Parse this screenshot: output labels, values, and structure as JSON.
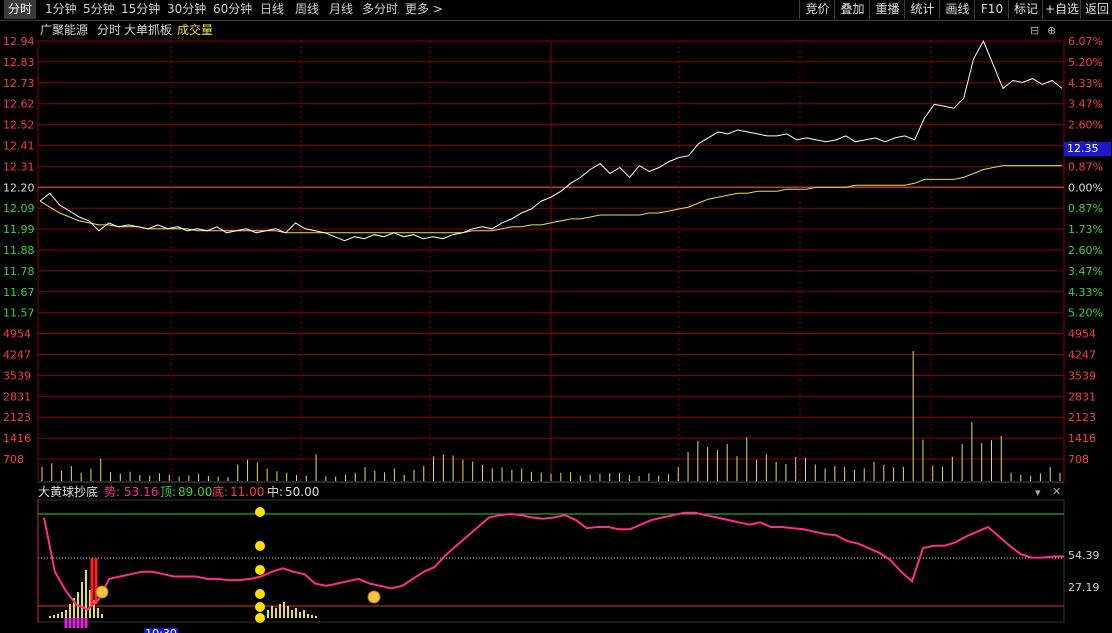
{
  "toolbar": {
    "tabs": [
      "分时",
      "1分钟",
      "5分钟",
      "15分钟",
      "30分钟",
      "60分钟",
      "日线",
      "周线",
      "月线",
      "多分时",
      "更多 >"
    ],
    "right_buttons": [
      "竞价",
      "叠加",
      "重播",
      "统计",
      "画线",
      "F10",
      "标记",
      "+自选",
      "返回"
    ]
  },
  "header": {
    "stock_name": "广聚能源",
    "view": "分时",
    "feature": "大单抓板",
    "volume_label": "成交量"
  },
  "price_axis": {
    "left": [
      "12.94",
      "12.83",
      "12.73",
      "12.62",
      "12.52",
      "12.41",
      "12.31",
      "12.20",
      "12.09",
      "11.99",
      "11.88",
      "11.78",
      "11.67",
      "11.57"
    ],
    "right": [
      "6.07%",
      "5.20%",
      "4.33%",
      "3.47%",
      "2.60%",
      "1.73%",
      "0.87%",
      "0.00%",
      "0.87%",
      "1.73%",
      "2.60%",
      "3.47%",
      "4.33%",
      "5.20%"
    ],
    "current_price": "12.35"
  },
  "volume_axis": [
    "4954",
    "4247",
    "3539",
    "2831",
    "2123",
    "1416",
    "708"
  ],
  "indicator": {
    "name": "大黄球抄底",
    "shi_label": "势:",
    "shi_value": "53.16",
    "ding_label": "顶:",
    "ding_value": "89.00",
    "di_label": "底:",
    "di_value": "11.00",
    "zhong_label": "中:",
    "zhong_value": "50.00",
    "right_labels": [
      "54.39",
      "27.19"
    ]
  },
  "time_axis": [
    "10:30"
  ],
  "colors": {
    "up": "#ff3b3b",
    "down": "#37d437",
    "price_line": "#ffffff",
    "avg_line": "#e8e04a",
    "grid": "#8b0000",
    "volume": "#e8e04a",
    "indicator": "#ff2d8a",
    "yellow_ball": "#ffe000"
  },
  "chart_data": {
    "type": "line",
    "prev_close": 12.2,
    "price": [
      12.13,
      12.17,
      12.11,
      12.08,
      12.05,
      12.03,
      11.98,
      12.02,
      12.0,
      12.01,
      12.0,
      11.99,
      12.01,
      11.99,
      12.0,
      11.98,
      11.99,
      11.98,
      12.0,
      11.97,
      11.98,
      11.99,
      11.97,
      11.98,
      11.99,
      11.97,
      12.02,
      11.99,
      11.98,
      11.97,
      11.95,
      11.93,
      11.95,
      11.94,
      11.96,
      11.95,
      11.97,
      11.95,
      11.96,
      11.94,
      11.95,
      11.94,
      11.96,
      11.97,
      11.99,
      12.0,
      11.99,
      12.02,
      12.04,
      12.07,
      12.09,
      12.13,
      12.15,
      12.18,
      12.22,
      12.25,
      12.29,
      12.32,
      12.27,
      12.3,
      12.25,
      12.31,
      12.28,
      12.3,
      12.33,
      12.35,
      12.36,
      12.42,
      12.45,
      12.48,
      12.47,
      12.49,
      12.48,
      12.47,
      12.46,
      12.46,
      12.47,
      12.44,
      12.45,
      12.44,
      12.43,
      12.44,
      12.46,
      12.43,
      12.44,
      12.45,
      12.43,
      12.45,
      12.46,
      12.44,
      12.55,
      12.62,
      12.61,
      12.6,
      12.65,
      12.85,
      12.94,
      12.82,
      12.7,
      12.74,
      12.73,
      12.75,
      12.72,
      12.74,
      12.7
    ],
    "avg_price": [
      12.13,
      12.1,
      12.07,
      12.05,
      12.03,
      12.02,
      12.01,
      12.01,
      12.0,
      12.0,
      12.0,
      11.99,
      11.99,
      11.99,
      11.99,
      11.99,
      11.98,
      11.98,
      11.98,
      11.98,
      11.98,
      11.98,
      11.98,
      11.98,
      11.98,
      11.97,
      11.97,
      11.97,
      11.97,
      11.97,
      11.97,
      11.97,
      11.97,
      11.97,
      11.97,
      11.97,
      11.97,
      11.97,
      11.97,
      11.97,
      11.97,
      11.97,
      11.97,
      11.97,
      11.98,
      11.98,
      11.98,
      11.99,
      12.0,
      12.0,
      12.01,
      12.01,
      12.02,
      12.03,
      12.04,
      12.04,
      12.05,
      12.06,
      12.06,
      12.06,
      12.06,
      12.06,
      12.07,
      12.07,
      12.08,
      12.09,
      12.1,
      12.12,
      12.14,
      12.15,
      12.16,
      12.17,
      12.17,
      12.18,
      12.18,
      12.18,
      12.19,
      12.19,
      12.19,
      12.2,
      12.2,
      12.2,
      12.2,
      12.21,
      12.21,
      12.21,
      12.21,
      12.21,
      12.21,
      12.22,
      12.24,
      12.24,
      12.24,
      12.24,
      12.25,
      12.27,
      12.29,
      12.3,
      12.31,
      12.31,
      12.31,
      12.31,
      12.31,
      12.31,
      12.31
    ],
    "volume": [
      480,
      600,
      350,
      500,
      280,
      420,
      760,
      300,
      250,
      310,
      200,
      180,
      260,
      210,
      150,
      190,
      240,
      170,
      150,
      130,
      560,
      720,
      610,
      420,
      330,
      280,
      200,
      180,
      900,
      160,
      150,
      220,
      280,
      470,
      340,
      300,
      420,
      210,
      380,
      510,
      830,
      900,
      860,
      720,
      660,
      540,
      430,
      460,
      380,
      420,
      310,
      290,
      250,
      280,
      300,
      180,
      220,
      240,
      260,
      280,
      210,
      170,
      260,
      180,
      230,
      470,
      980,
      1350,
      1150,
      1050,
      1250,
      840,
      1480,
      720,
      900,
      650,
      580,
      820,
      780,
      560,
      420,
      510,
      470,
      380,
      430,
      650,
      540,
      460,
      480,
      4400,
      1400,
      520,
      480,
      820,
      1250,
      2000,
      1280,
      1380,
      1520,
      280,
      210,
      180,
      260,
      470,
      280
    ],
    "indicator": [
      86,
      40,
      24,
      12,
      8,
      16,
      34,
      36,
      38,
      40,
      40,
      38,
      36,
      36,
      36,
      34,
      34,
      33,
      33,
      34,
      36,
      40,
      43,
      40,
      38,
      30,
      28,
      30,
      32,
      34,
      30,
      28,
      26,
      28,
      34,
      40,
      44,
      54,
      62,
      70,
      78,
      86,
      88,
      89,
      88,
      86,
      85,
      86,
      88,
      84,
      77,
      78,
      78,
      76,
      76,
      80,
      84,
      86,
      88,
      90,
      90,
      88,
      86,
      84,
      82,
      80,
      82,
      78,
      78,
      77,
      76,
      74,
      72,
      71,
      66,
      64,
      60,
      56,
      50,
      40,
      32,
      60,
      62,
      62,
      65,
      70,
      74,
      78,
      70,
      62,
      55,
      52,
      52,
      53,
      53
    ]
  }
}
